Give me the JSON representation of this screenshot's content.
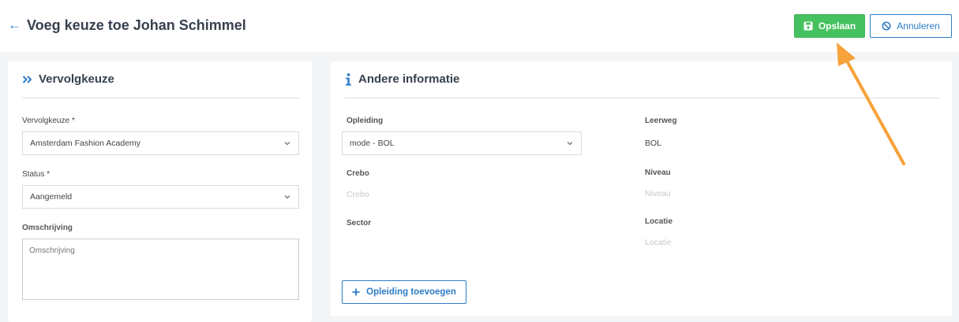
{
  "header": {
    "title": "Voeg keuze toe Johan Schimmel",
    "save_label": "Opslaan",
    "cancel_label": "Annuleren"
  },
  "left_card": {
    "title": "Vervolgkeuze",
    "vervolgkeuze_label": "Vervolgkeuze *",
    "vervolgkeuze_value": "Amsterdam Fashion Academy",
    "status_label": "Status *",
    "status_value": "Aangemeld",
    "omschrijving_label": "Omschrijving",
    "omschrijving_placeholder": "Omschrijving"
  },
  "right_card": {
    "title": "Andere informatie",
    "opleiding_label": "Opleiding",
    "opleiding_value": "mode - BOL",
    "leerweg_label": "Leerweg",
    "leerweg_value": "BOL",
    "crebo_label": "Crebo",
    "crebo_placeholder": "Crebo",
    "niveau_label": "Niveau",
    "niveau_placeholder": "Niveau",
    "sector_label": "Sector",
    "locatie_label": "Locatie",
    "locatie_placeholder": "Locatie",
    "add_label": "Opleiding toevoegen"
  },
  "colors": {
    "accent": "#2c7cc7",
    "save": "#45c15f",
    "annotation": "#f7a23a"
  },
  "icons": {
    "back": "arrow-left-icon",
    "save": "floppy-disk-icon",
    "cancel": "ban-icon",
    "left_card": "double-chevron-right-icon",
    "right_card": "info-icon",
    "add": "plus-icon"
  }
}
